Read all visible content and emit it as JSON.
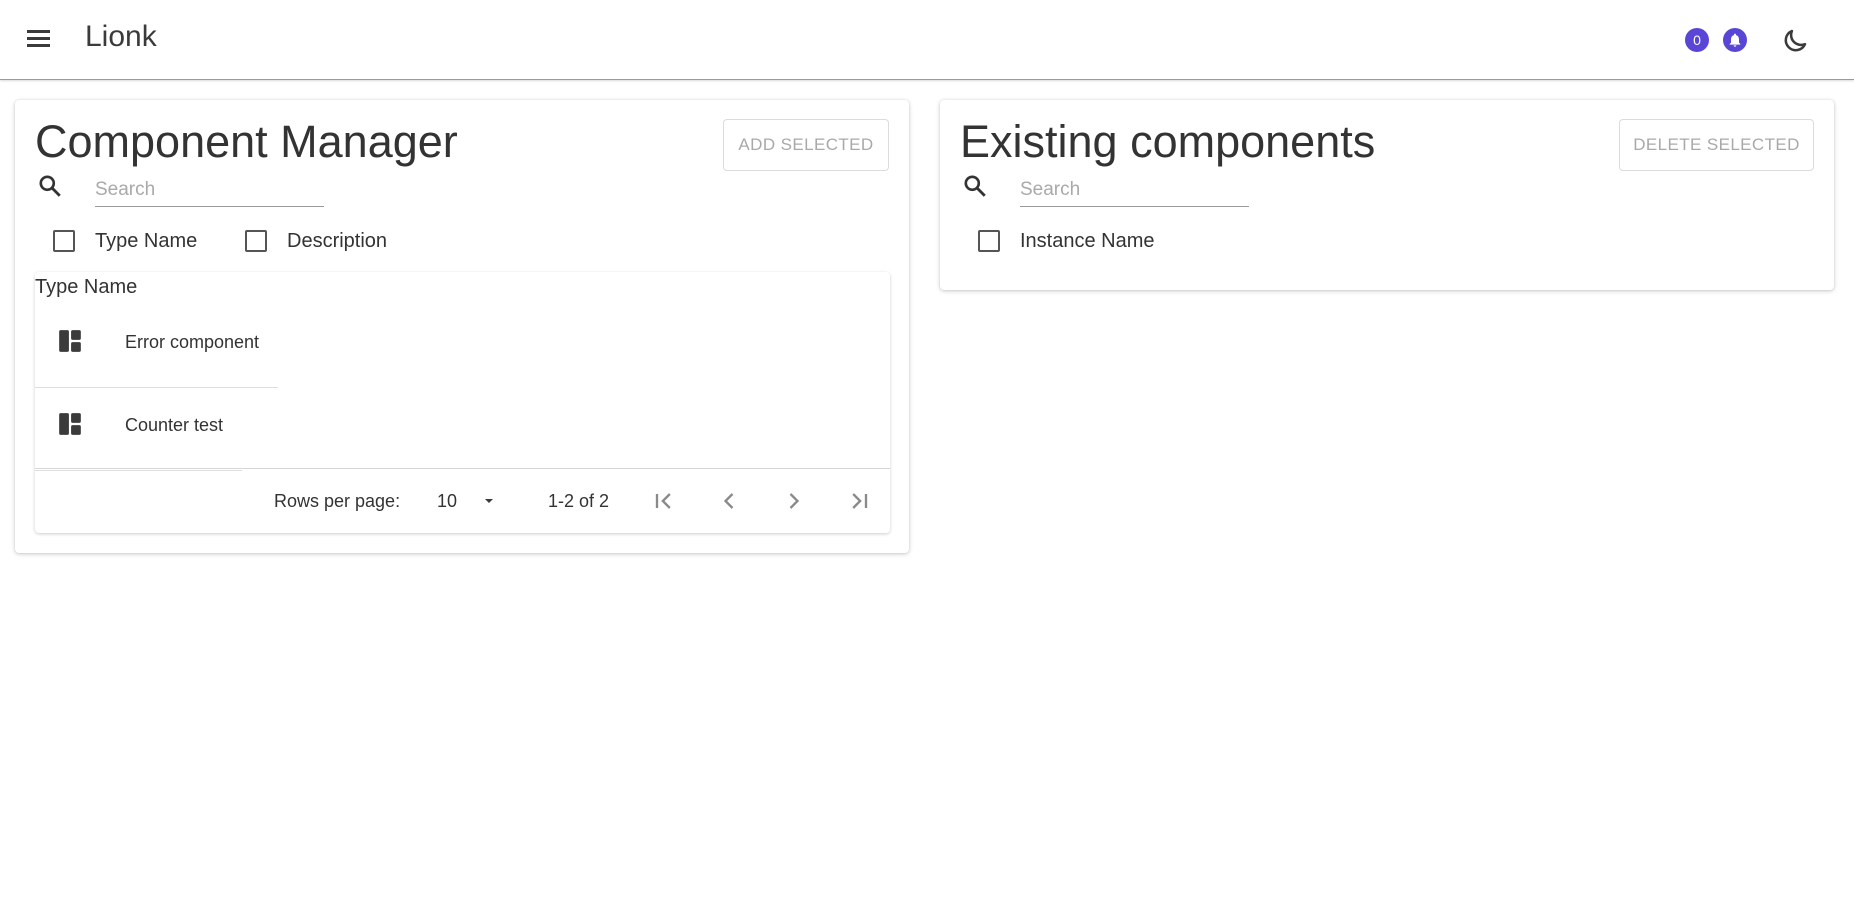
{
  "app": {
    "title": "Lionk",
    "notification_count": "0",
    "accent_color": "#5a46d6"
  },
  "component_manager": {
    "title": "Component Manager",
    "add_button": "ADD SELECTED",
    "search_placeholder": "Search",
    "filters": [
      {
        "label": "Type Name"
      },
      {
        "label": "Description"
      }
    ],
    "table": {
      "column_header": "Type Name",
      "rows": [
        {
          "icon": "dashboard-icon",
          "label": "Error component"
        },
        {
          "icon": "dashboard-icon",
          "label": "Counter test"
        }
      ],
      "rows_per_page_label": "Rows per page:",
      "rows_per_page_value": "10",
      "range_text": "1-2 of 2"
    }
  },
  "existing_components": {
    "title": "Existing components",
    "delete_button": "DELETE SELECTED",
    "search_placeholder": "Search",
    "filters": [
      {
        "label": "Instance Name"
      }
    ]
  }
}
